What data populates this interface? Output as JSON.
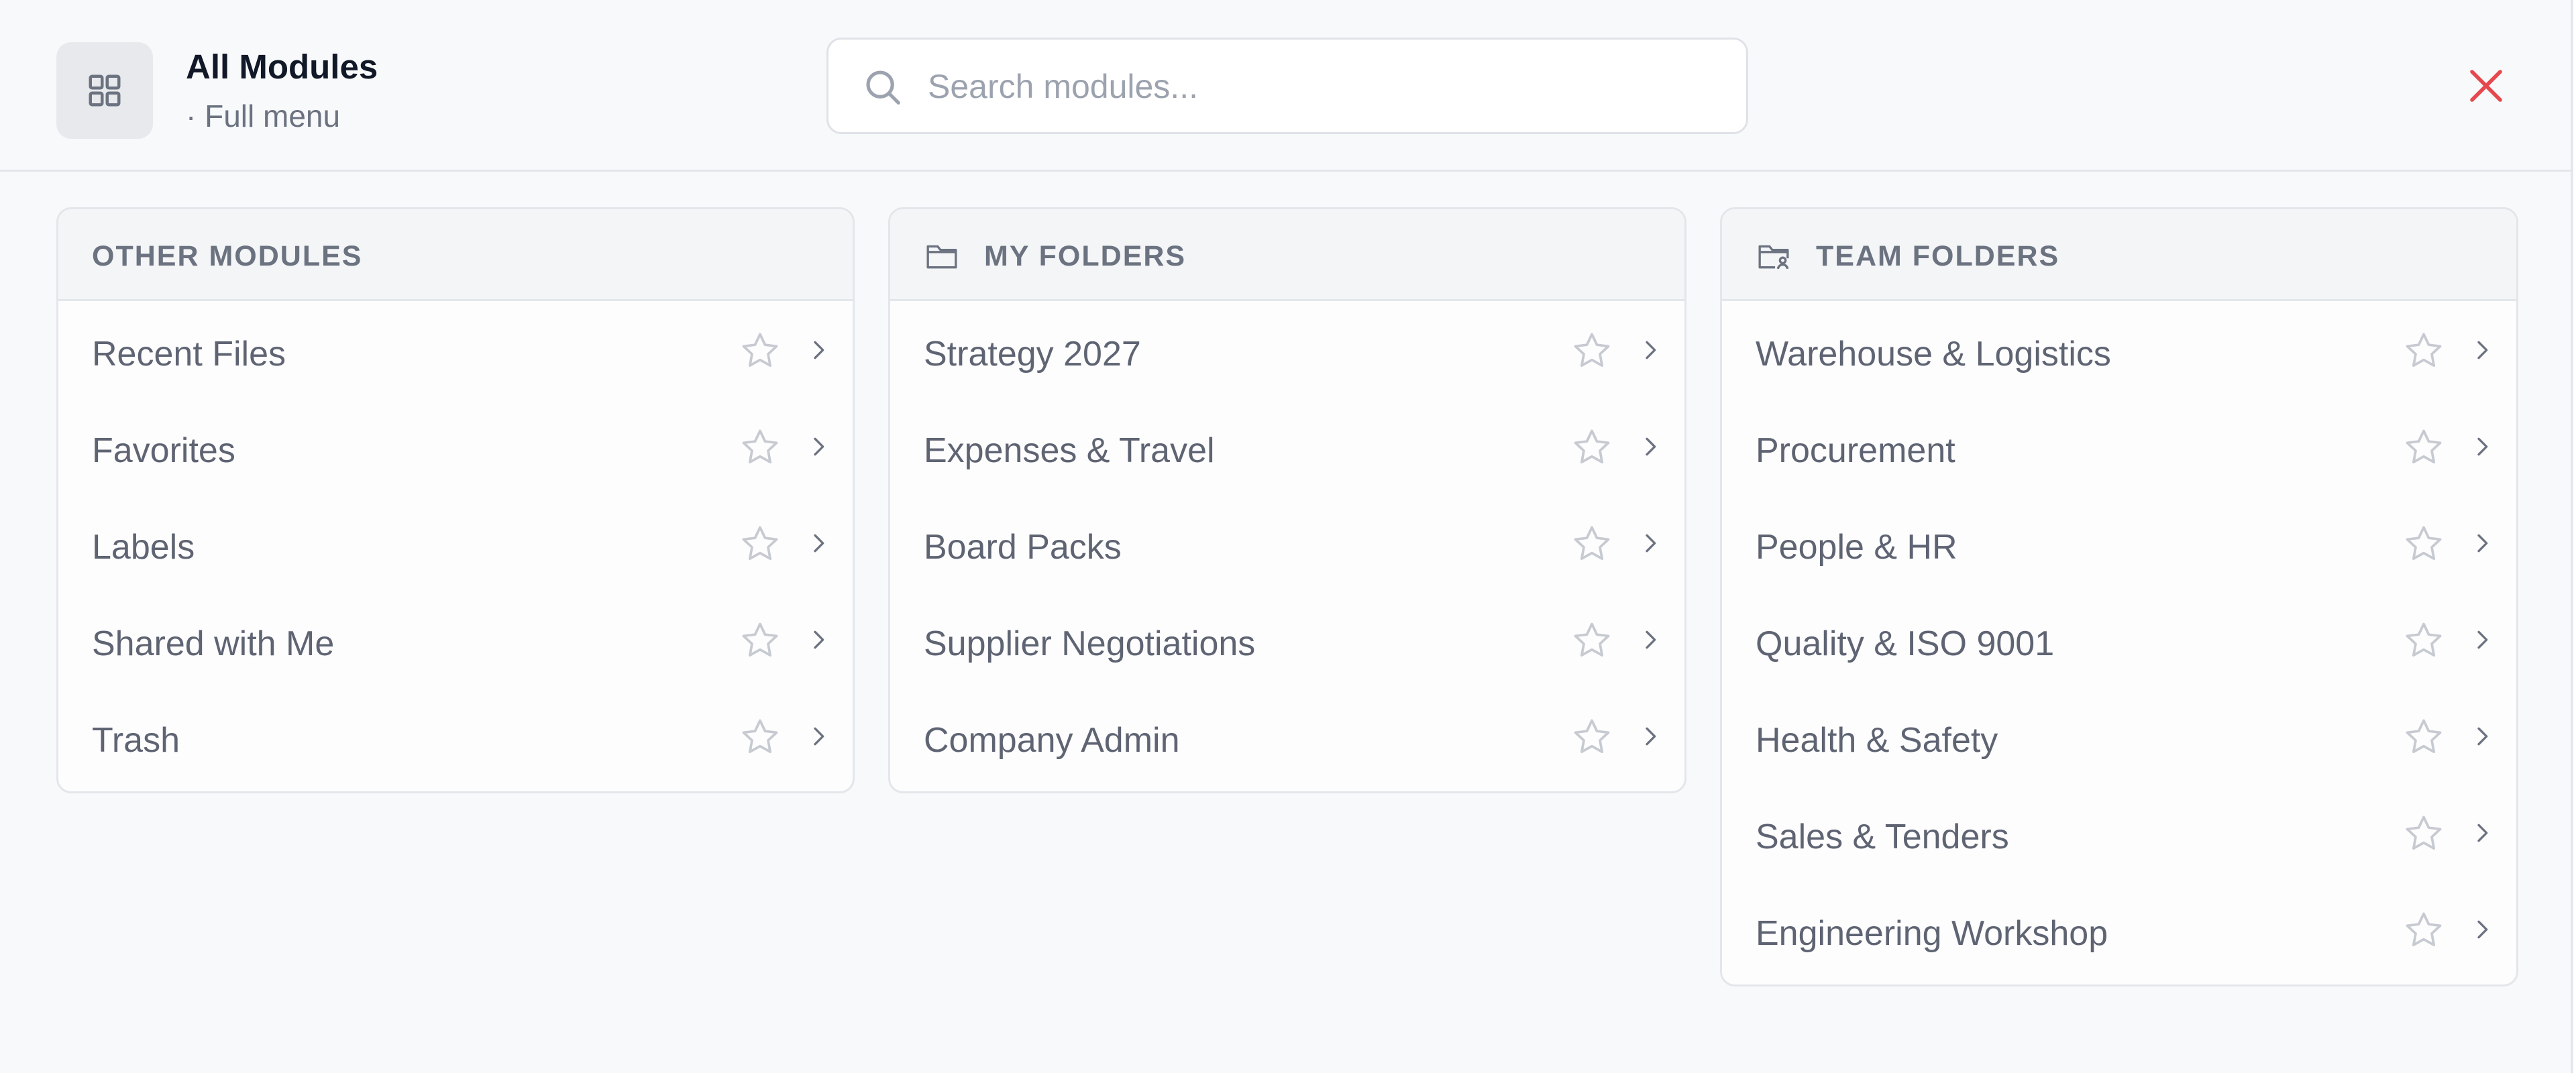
{
  "header": {
    "title": "All Modules",
    "subtitle": "· Full menu",
    "search_placeholder": "Search modules...",
    "search_value": ""
  },
  "icons": {
    "app": "grid-icon",
    "search": "search-icon",
    "close": "close-icon",
    "star": "star-outline-icon",
    "chevron": "chevron-right-icon",
    "folder": "folder-icon",
    "team_folder": "folder-user-icon"
  },
  "colors": {
    "close": "#e5484d",
    "text_muted": "#5f6473",
    "title": "#111827"
  },
  "sections": {
    "other": {
      "label": "OTHER MODULES",
      "items": [
        "Recent Files",
        "Favorites",
        "Labels",
        "Shared with Me",
        "Trash"
      ]
    },
    "my_folders": {
      "label": "MY FOLDERS",
      "items": [
        "Strategy 2027",
        "Expenses & Travel",
        "Board Packs",
        "Supplier Negotiations",
        "Company Admin"
      ]
    },
    "team_folders": {
      "label": "TEAM FOLDERS",
      "items": [
        "Warehouse & Logistics",
        "Procurement",
        "People & HR",
        "Quality & ISO 9001",
        "Health & Safety",
        "Sales & Tenders",
        "Engineering Workshop"
      ]
    }
  }
}
